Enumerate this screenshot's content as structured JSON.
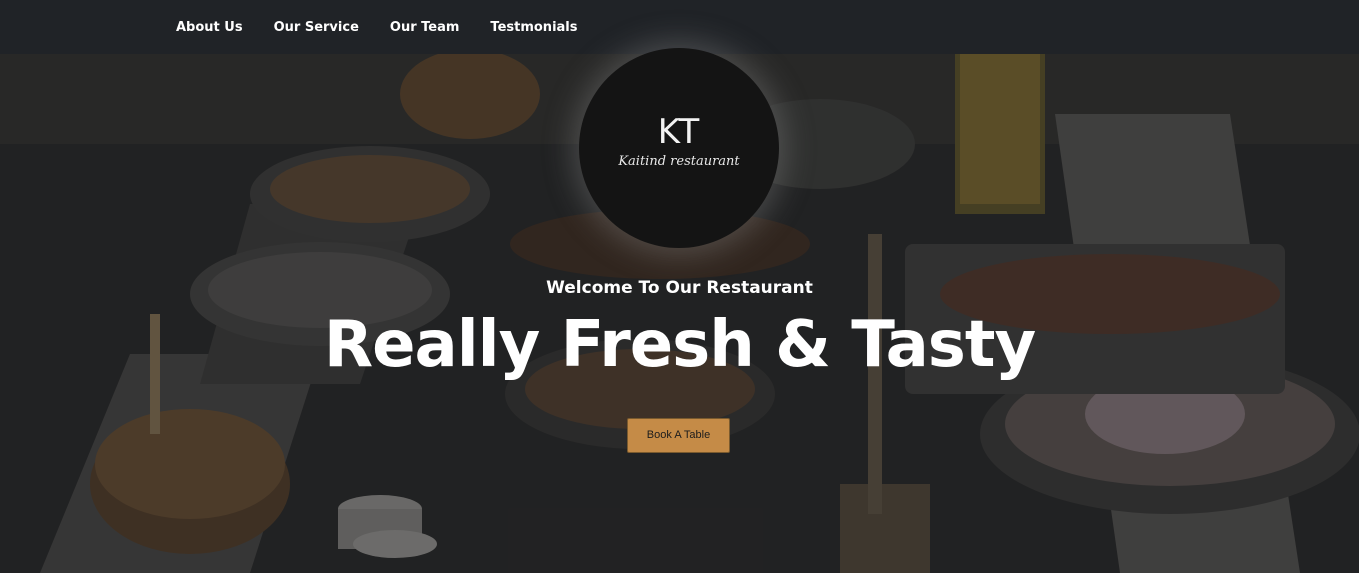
{
  "nav": {
    "items": [
      {
        "label": "About Us"
      },
      {
        "label": "Our Service"
      },
      {
        "label": "Our Team"
      },
      {
        "label": "Testmonials"
      }
    ]
  },
  "logo": {
    "monogram": "KT",
    "subtitle": "Kaitind restaurant"
  },
  "hero": {
    "welcome": "Welcome To Our Restaurant",
    "headline": "Really Fresh & Tasty",
    "cta_label": "Book A Table"
  },
  "colors": {
    "navbar_bg": "#202327",
    "accent": "#c58b47",
    "text_light": "#ffffff",
    "logo_bg": "#141414"
  },
  "icons": {
    "background": "food-table-photo"
  }
}
